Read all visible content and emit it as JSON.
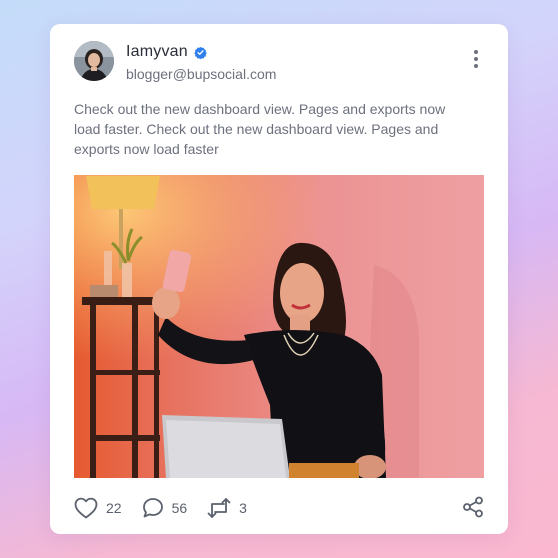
{
  "post": {
    "author": "Iamyvan",
    "handle": "blogger@bupsocial.com",
    "text": "Check out the new dashboard view. Pages and exports now load faster. Check out the new dashboard view. Pages and exports now load faster",
    "verified": true
  },
  "stats": {
    "likes": "22",
    "comments": "56",
    "reposts": "3"
  },
  "icons": {
    "verified": "verified-badge-icon",
    "menu": "more-vertical-icon",
    "like": "heart-icon",
    "comment": "comment-icon",
    "repost": "repost-icon",
    "share": "share-icon"
  },
  "colors": {
    "accent": "#2f80ed",
    "text": "#2b2f3a",
    "muted": "#6c717d"
  }
}
